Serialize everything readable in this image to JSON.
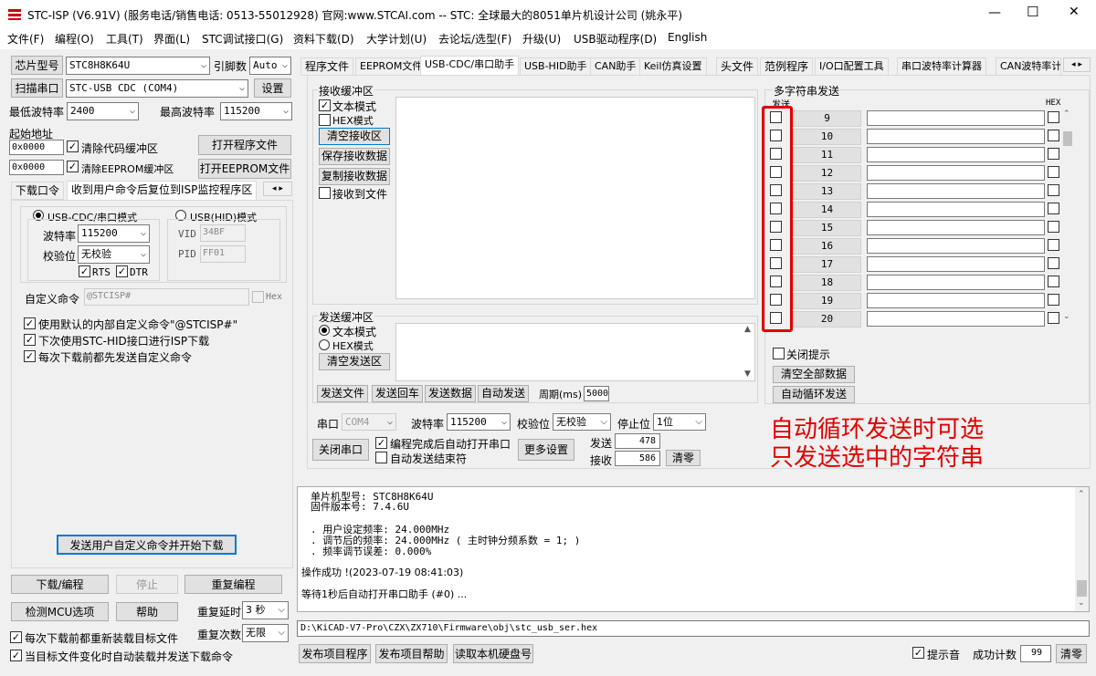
{
  "title": "STC-ISP (V6.91V) (服务电话/销售电话: 0513-55012928) 官网:www.STCAI.com  -- STC: 全球最大的8051单片机设计公司 (姚永平)",
  "window_controls": {
    "minimize": "—",
    "maximize": "☐",
    "close": "✕"
  },
  "menu": [
    "文件(F)",
    "编程(O)",
    "工具(T)",
    "界面(L)",
    "STC调试接口(G)",
    "资料下载(D)",
    "大学计划(U)",
    "去论坛/选型(F)",
    "升级(U)",
    "USB驱动程序(D)",
    "English"
  ],
  "left": {
    "chip_label": "芯片型号",
    "chip_value": "STC8H8K64U",
    "pin_label": "引脚数",
    "pin_value": "Auto",
    "scan_button": "扫描串口",
    "port_value": "STC-USB CDC (COM4)",
    "settings_button": "设置",
    "min_baud_label": "最低波特率",
    "min_baud_value": "2400",
    "max_baud_label": "最高波特率",
    "max_baud_value": "115200",
    "start_addr_label": "起始地址",
    "addr1": "0x0000",
    "clear_code_label": "清除代码缓冲区",
    "open_prog_button": "打开程序文件",
    "addr2": "0x0000",
    "clear_eeprom_label": "清除EEPROM缓冲区",
    "open_eeprom_button": "打开EEPROM文件",
    "tabs": [
      "下载口令",
      "收到用户命令后复位到ISP监控程序区"
    ],
    "usb_cdc_mode": "USB-CDC/串口模式",
    "usb_hid_mode": "USB(HID)模式",
    "baud_label": "波特率",
    "baud_value": "115200",
    "parity_label": "校验位",
    "parity_value": "无校验",
    "rts_label": "RTS",
    "dtr_label": "DTR",
    "vid_label": "VID",
    "vid_value": "34BF",
    "pid_label": "PID",
    "pid_value": "FF01",
    "custom_cmd_label": "自定义命令",
    "custom_cmd_value": "@STCISP#",
    "hex_label": "Hex",
    "opt1": "使用默认的内部自定义命令\"@STCISP#\"",
    "opt2": "下次使用STC-HID接口进行ISP下载",
    "opt3": "每次下载前都先发送自定义命令",
    "send_download_button": "发送用户自定义命令并开始下载",
    "download_button": "下载/编程",
    "stop_button": "停止",
    "reprogram_button": "重复编程",
    "check_mcu_button": "检测MCU选项",
    "help_button": "帮助",
    "repeat_delay_label": "重复延时",
    "repeat_delay_value": "3 秒",
    "repeat_count_label": "重复次数",
    "repeat_count_value": "无限",
    "reload_label": "每次下载前都重新装载目标文件",
    "auto_reload_label": "当目标文件变化时自动装载并发送下载命令"
  },
  "right_tabs": [
    "程序文件",
    "EEPROM文件",
    "USB-CDC/串口助手",
    "USB-HID助手",
    "CAN助手",
    "Keil仿真设置",
    "头文件",
    "范例程序",
    "I/O口配置工具",
    "串口波特率计算器",
    "CAN波特率计"
  ],
  "serial": {
    "recv_group": "接收缓冲区",
    "text_mode": "文本模式",
    "hex_mode": "HEX模式",
    "clear_recv": "清空接收区",
    "save_recv": "保存接收数据",
    "copy_recv": "复制接收数据",
    "recv_to_file": "接收到文件",
    "send_group": "发送缓冲区",
    "send_text_mode": "文本模式",
    "send_hex_mode": "HEX模式",
    "clear_send": "清空发送区",
    "send_file": "发送文件",
    "send_return": "发送回车",
    "send_data": "发送数据",
    "auto_send": "自动发送",
    "period_label": "周期(ms)",
    "period_value": "5000",
    "port_label": "串口",
    "port_value": "COM4",
    "baud_label": "波特率",
    "baud_value": "115200",
    "parity_label": "校验位",
    "parity_value": "无校验",
    "stop_label": "停止位",
    "stop_value": "1位",
    "close_port": "关闭串口",
    "auto_open": "编程完成后自动打开串口",
    "auto_send_end": "自动发送结束符",
    "more_settings": "更多设置",
    "sent_label": "发送",
    "sent_value": "478",
    "recv_label": "接收",
    "recv_value": "586",
    "clear_counts": "清零"
  },
  "multi": {
    "group": "多字符串发送",
    "send_header": "发送",
    "hex_header": "HEX",
    "rows": [
      "9",
      "10",
      "11",
      "12",
      "13",
      "14",
      "15",
      "16",
      "17",
      "18",
      "19",
      "20"
    ],
    "close_tip": "关闭提示",
    "clear_all": "清空全部数据",
    "auto_cycle": "自动循环发送"
  },
  "annotation": {
    "line1": "自动循环发送时可选",
    "line2": "只发送选中的字符串",
    "color": "#e00000"
  },
  "log": {
    "l1": "单片机型号: STC8H8K64U",
    "l2": "固件版本号: 7.4.6U",
    "l3": ". 用户设定频率: 24.000MHz",
    "l4": ". 调节后的频率: 24.000MHz ( 主时钟分频系数 = 1; )",
    "l5": ". 频率调节误差: 0.000%",
    "l6": "操作成功 !(2023-07-19 08:41:03)",
    "l7": "等待1秒后自动打开串口助手 (#0) ..."
  },
  "path": "D:\\KiCAD-V7-Pro\\CZX\\ZX710\\Firmware\\obj\\stc_usb_ser.hex",
  "bottom": {
    "publish_prog": "发布项目程序",
    "publish_help": "发布项目帮助",
    "read_disk": "读取本机硬盘号",
    "beep": "提示音",
    "success_label": "成功计数",
    "success_value": "99",
    "clear": "清零"
  }
}
